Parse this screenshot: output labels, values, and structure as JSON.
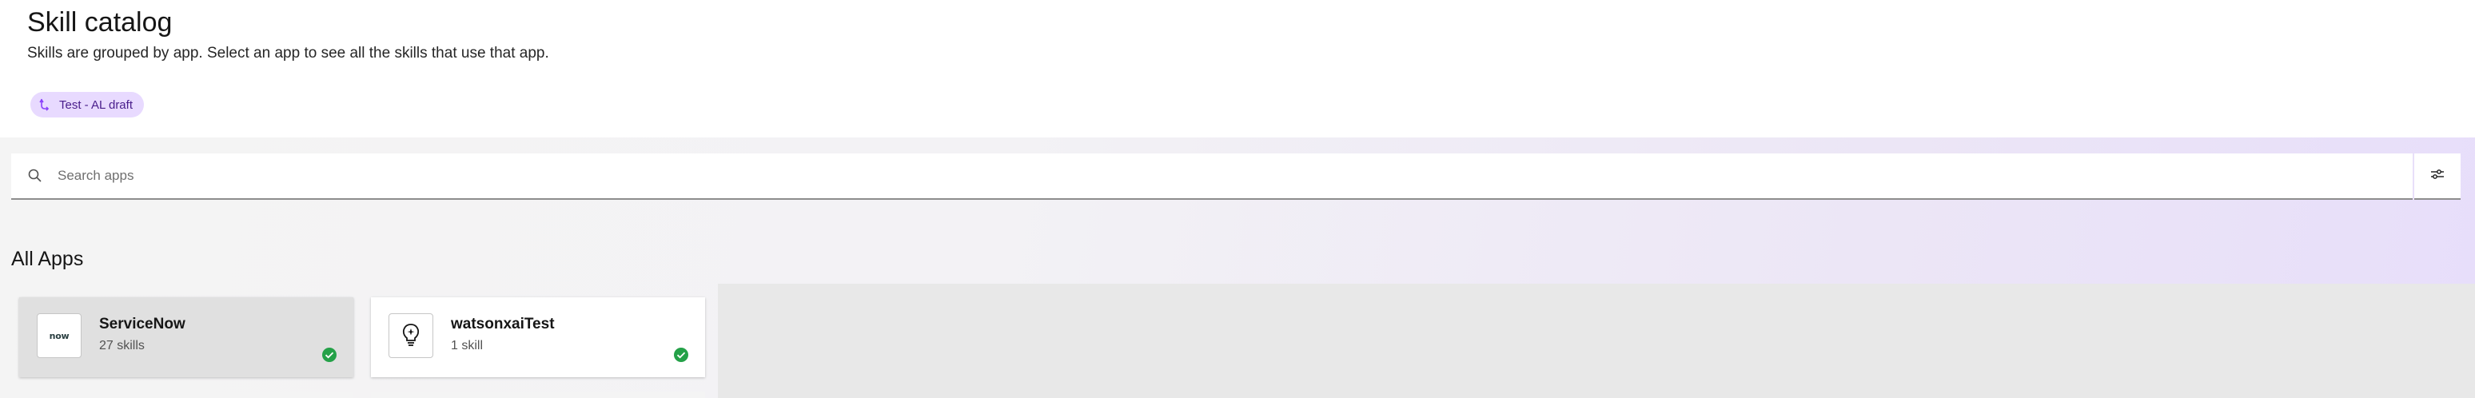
{
  "header": {
    "title": "Skill catalog",
    "subtitle": "Skills are grouped by app. Select an app to see all the skills that use that app.",
    "tag": {
      "label": "Test - AL draft",
      "icon": "flow-icon",
      "color": "#e8daff"
    }
  },
  "search": {
    "placeholder": "Search apps",
    "value": "",
    "icon": "search-icon",
    "filter_icon": "filter-sliders-icon"
  },
  "section": {
    "heading": "All Apps"
  },
  "apps": [
    {
      "name": "ServiceNow",
      "count": "27 skills",
      "logo_text": "now",
      "status": "check-icon",
      "selected": true
    },
    {
      "name": "watsonxaiTest",
      "count": "1 skill",
      "logo": "lightbulb-icon",
      "status": "check-icon",
      "selected": false
    }
  ],
  "colors": {
    "accent_purple": "#491d8b",
    "success_green": "#24a148",
    "selected_card": "#e0e0e0"
  }
}
